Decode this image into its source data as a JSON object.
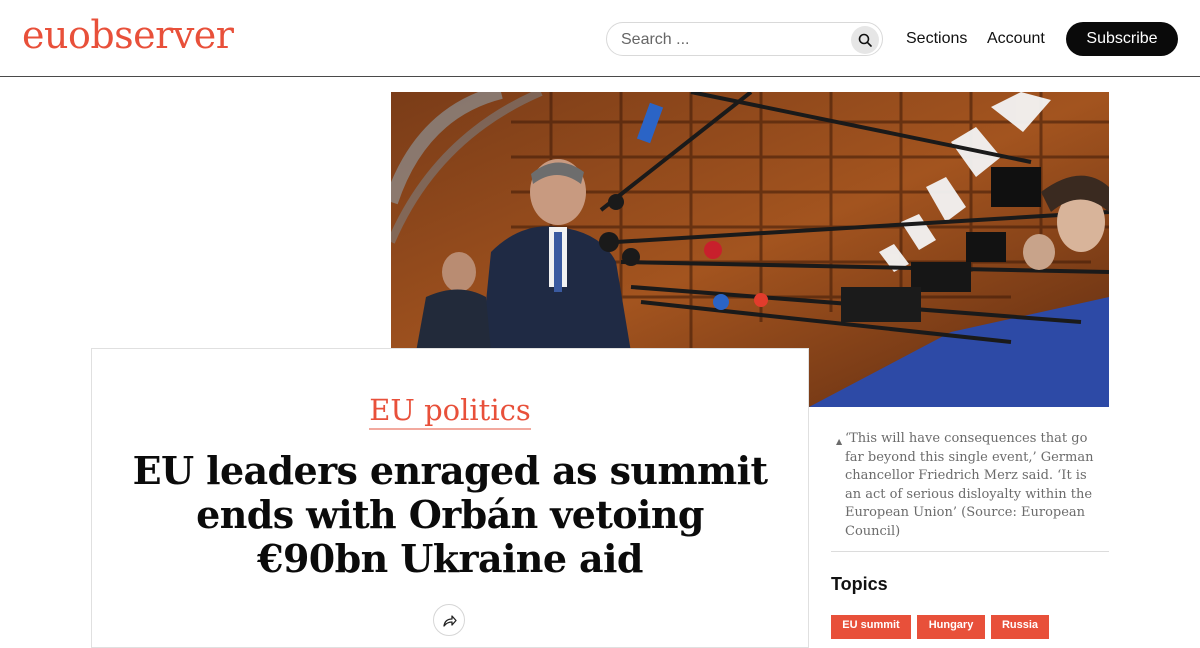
{
  "header": {
    "logo": "euobserver",
    "search_placeholder": "Search ...",
    "nav": {
      "sections": "Sections",
      "account": "Account"
    },
    "subscribe": "Subscribe"
  },
  "article": {
    "category": "EU politics",
    "headline": "EU leaders enraged as summit ends with Orbán vetoing €90bn Ukraine aid"
  },
  "photo": {
    "caption": "‘This will have consequences that go far beyond this single event,’ German chancellor Friedrich Merz said. ‘It is an act of serious disloyalty within the European Union’ (Source: European Council)"
  },
  "topics": {
    "title": "Topics",
    "tags": [
      "EU summit",
      "Hungary",
      "Russia"
    ]
  },
  "colors": {
    "brand": "#e8503a",
    "button_dark": "#0a0a0a"
  },
  "icons": {
    "search": "search-icon",
    "share": "share-icon"
  }
}
